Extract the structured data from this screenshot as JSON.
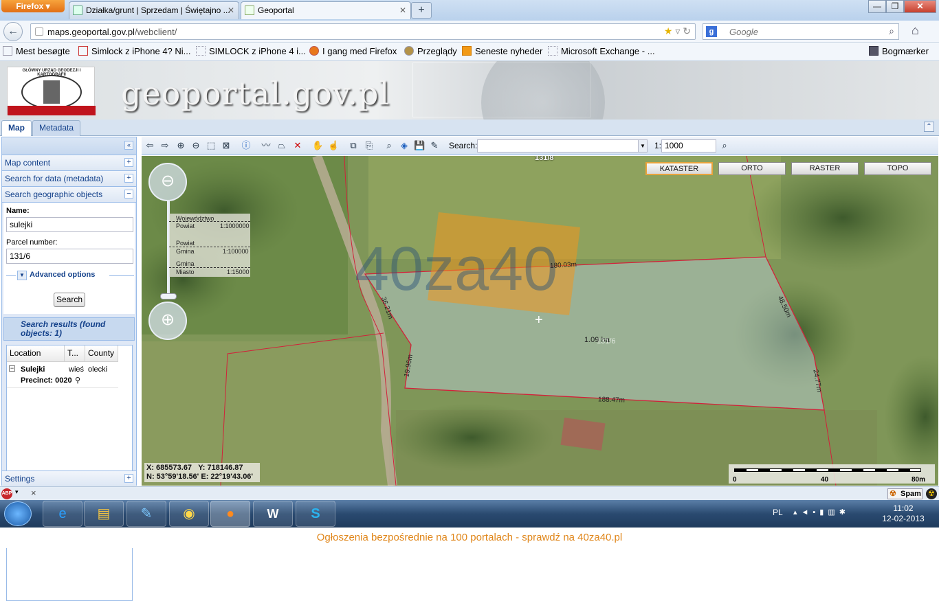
{
  "browser": {
    "app_button": "Firefox",
    "tabs": [
      {
        "label": "Działka/grunt | Sprzedam | Świętajno ..."
      },
      {
        "label": "Geoportal"
      }
    ],
    "url_domain": "maps.geoportal.gov.pl",
    "url_prefix": "",
    "url_path": "/webclient/",
    "search_placeholder": "Google",
    "bookmarks": [
      "Mest besøgte",
      "Simlock z iPhone 4? Ni...",
      "SIMLOCK z iPhone 4 i...",
      "I gang med Firefox",
      "Przeglądy",
      "Seneste nyheder",
      "Microsoft Exchange - ..."
    ],
    "bookmarks_menu": "Bogmærker"
  },
  "geoportal": {
    "logo_text": "GŁÓWNY URZĄD GEODEZJI I KARTOGRAFII",
    "title": "geoportal.gov.pl",
    "tabs": [
      "Map",
      "Metadata"
    ]
  },
  "left": {
    "sections": [
      "Map content",
      "Search for data (metadata)",
      "Search geographic objects"
    ],
    "name_label": "Name:",
    "name_value": "sulejki",
    "parcel_label": "Parcel number:",
    "parcel_value": "131/6",
    "advanced": "Advanced options",
    "search_button": "Search",
    "results_header": "Search results (found objects: 1)",
    "columns": [
      "Location",
      "T...",
      "County"
    ],
    "result": {
      "location": "Sulejki",
      "type": "wieś",
      "county": "olecki",
      "precinct": "Precinct: 0020"
    },
    "settings": "Settings"
  },
  "toolbar": {
    "search_label": "Search:",
    "scale_prefix": "1:",
    "scale_value": "1000"
  },
  "map": {
    "layers": [
      "KATASTER",
      "ORTO",
      "RASTER",
      "TOPO"
    ],
    "scale_levels": [
      [
        "Województwo",
        ""
      ],
      [
        "Powiat",
        "1:1000000"
      ],
      [
        "Powiat",
        ""
      ],
      [
        "Gmina",
        "1:100000"
      ],
      [
        "Gmina",
        ""
      ],
      [
        "Miasto",
        "1:15000"
      ]
    ],
    "parcel_label": "131/8",
    "area": "1.09 ha",
    "parcel_id": "131/6",
    "edges": [
      "180.03m",
      "48.50m",
      "24.77m",
      "188.47m",
      "19.96m",
      "36.21m"
    ],
    "watermark": "40za40",
    "coords": {
      "x": "X: 685573.67",
      "y": "Y: 718146.87",
      "n": "N: 53°59'18.56'",
      "e": "E: 22°19'43.06'"
    },
    "scalebar": [
      "0",
      "40",
      "80m"
    ]
  },
  "status": {
    "spam": "Spam"
  },
  "taskbar": {
    "lang": "PL",
    "time": "11:02",
    "date": "12-02-2013"
  },
  "footer": "Ogłoszenia bezpośrednie na 100 portalach - sprawdź na 40za40.pl"
}
